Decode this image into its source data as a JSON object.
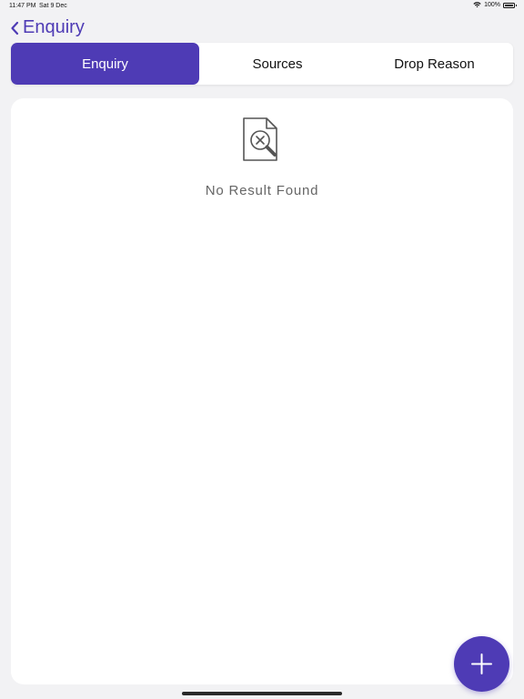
{
  "status_bar": {
    "time": "11:47 PM",
    "date": "Sat 9 Dec",
    "battery": "100%",
    "icons": [
      "wifi-icon",
      "battery-icon"
    ]
  },
  "nav": {
    "title": "Enquiry",
    "back_icon": "chevron-left-icon"
  },
  "tabs": [
    {
      "label": "Enquiry",
      "active": true
    },
    {
      "label": "Sources",
      "active": false
    },
    {
      "label": "Drop Reason",
      "active": false
    }
  ],
  "empty_state": {
    "icon": "document-search-x-icon",
    "text": "No Result Found"
  },
  "fab": {
    "icon": "plus-icon"
  },
  "colors": {
    "accent": "#4e3bb5",
    "background": "#f2f2f4",
    "card": "#ffffff",
    "muted_text": "#666666"
  }
}
